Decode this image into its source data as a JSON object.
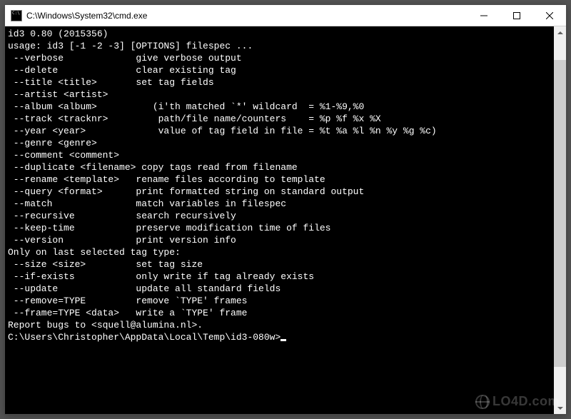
{
  "window": {
    "title": "C:\\Windows\\System32\\cmd.exe"
  },
  "console": {
    "lines": [
      "id3 0.80 (2015356)",
      "usage: id3 [-1 -2 -3] [OPTIONS] filespec ...",
      " --verbose             give verbose output",
      " --delete              clear existing tag",
      " --title <title>       set tag fields",
      " --artist <artist>",
      " --album <album>          (i'th matched `*' wildcard  = %1-%9,%0",
      " --track <tracknr>         path/file name/counters    = %p %f %x %X",
      " --year <year>             value of tag field in file = %t %a %l %n %y %g %c)",
      " --genre <genre>",
      " --comment <comment>",
      " --duplicate <filename> copy tags read from filename",
      " --rename <template>   rename files according to template",
      " --query <format>      print formatted string on standard output",
      " --match               match variables in filespec",
      " --recursive           search recursively",
      " --keep-time           preserve modification time of files",
      " --version             print version info",
      "Only on last selected tag type:",
      " --size <size>         set tag size",
      " --if-exists           only write if tag already exists",
      " --update              update all standard fields",
      " --remove=TYPE         remove `TYPE' frames",
      " --frame=TYPE <data>   write a `TYPE' frame",
      "",
      "Report bugs to <squell@alumina.nl>.",
      "",
      "C:\\Users\\Christopher\\AppData\\Local\\Temp\\id3-080w>"
    ],
    "prompt_line_index": 27
  },
  "watermark": {
    "text": "LO4D.com"
  }
}
